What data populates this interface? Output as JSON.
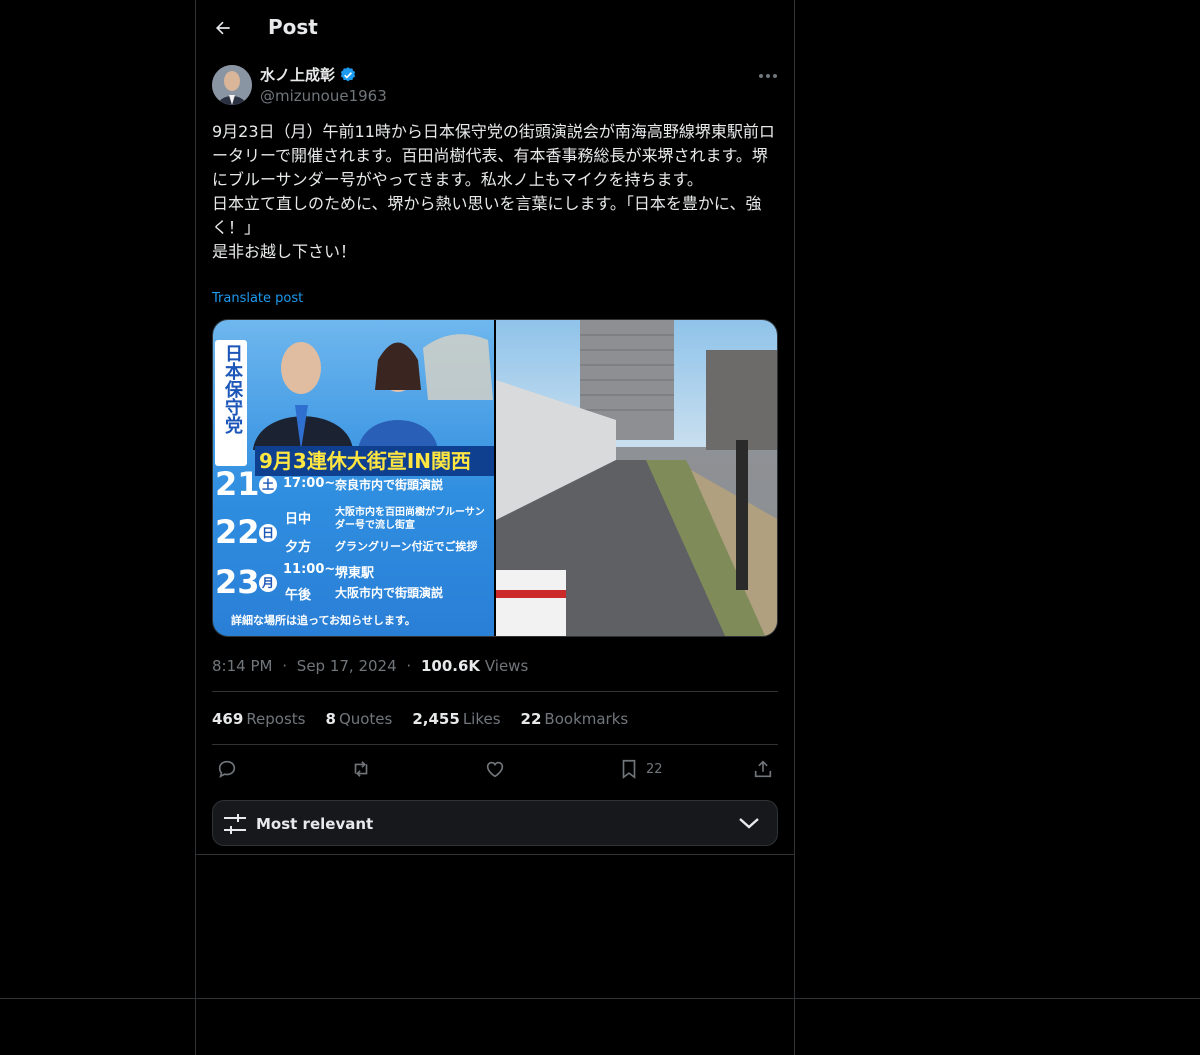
{
  "header": {
    "title": "Post"
  },
  "author": {
    "name": "水ノ上成彰",
    "handle": "@mizunoue1963"
  },
  "post": {
    "text": "9月23日（月）午前11時から日本保守党の街頭演説会が南海高野線堺東駅前ロータリーで開催されます。百田尚樹代表、有本香事務総長が来堺されます。堺にブルーサンダー号がやってきます。私水ノ上もマイクを持ちます。\n日本立て直しのために、堺から熱い思いを言葉にします。「日本を豊かに、強く！」\n是非お越し下さい！",
    "translate_label": "Translate post"
  },
  "media": {
    "flyer": {
      "party": "日本保守党",
      "banner": "9月3連休大街宣IN関西",
      "rows": [
        {
          "day": "21",
          "weekday": "土",
          "time": "17:00~",
          "text": "奈良市内で街頭演説"
        },
        {
          "day": "22",
          "weekday": "日",
          "time": "日中",
          "text": "大阪市内を百田尚樹がブルーサンダー号で流し街宣"
        },
        {
          "day": "",
          "weekday": "",
          "time": "夕方",
          "text": "グラングリーン付近でご挨拶"
        },
        {
          "day": "23",
          "weekday": "月",
          "time": "11:00~",
          "text": "堺東駅"
        },
        {
          "day": "",
          "weekday": "",
          "time": "午後",
          "text": "大阪市内で街頭演説"
        }
      ],
      "footer": "詳細な場所は追ってお知らせします。"
    }
  },
  "meta": {
    "time": "8:14 PM",
    "date": "Sep 17, 2024",
    "views_count": "100.6K",
    "views_label": "Views",
    "sep": "·"
  },
  "stats": {
    "reposts": {
      "count": "469",
      "label": "Reposts"
    },
    "quotes": {
      "count": "8",
      "label": "Quotes"
    },
    "likes": {
      "count": "2,455",
      "label": "Likes"
    },
    "bookmarks": {
      "count": "22",
      "label": "Bookmarks"
    }
  },
  "actions": {
    "bookmark_count": "22"
  },
  "sort": {
    "label": "Most relevant"
  },
  "colors": {
    "accent": "#1d9bf0",
    "background": "#000000",
    "border": "#2f3336",
    "muted": "#71767b"
  }
}
